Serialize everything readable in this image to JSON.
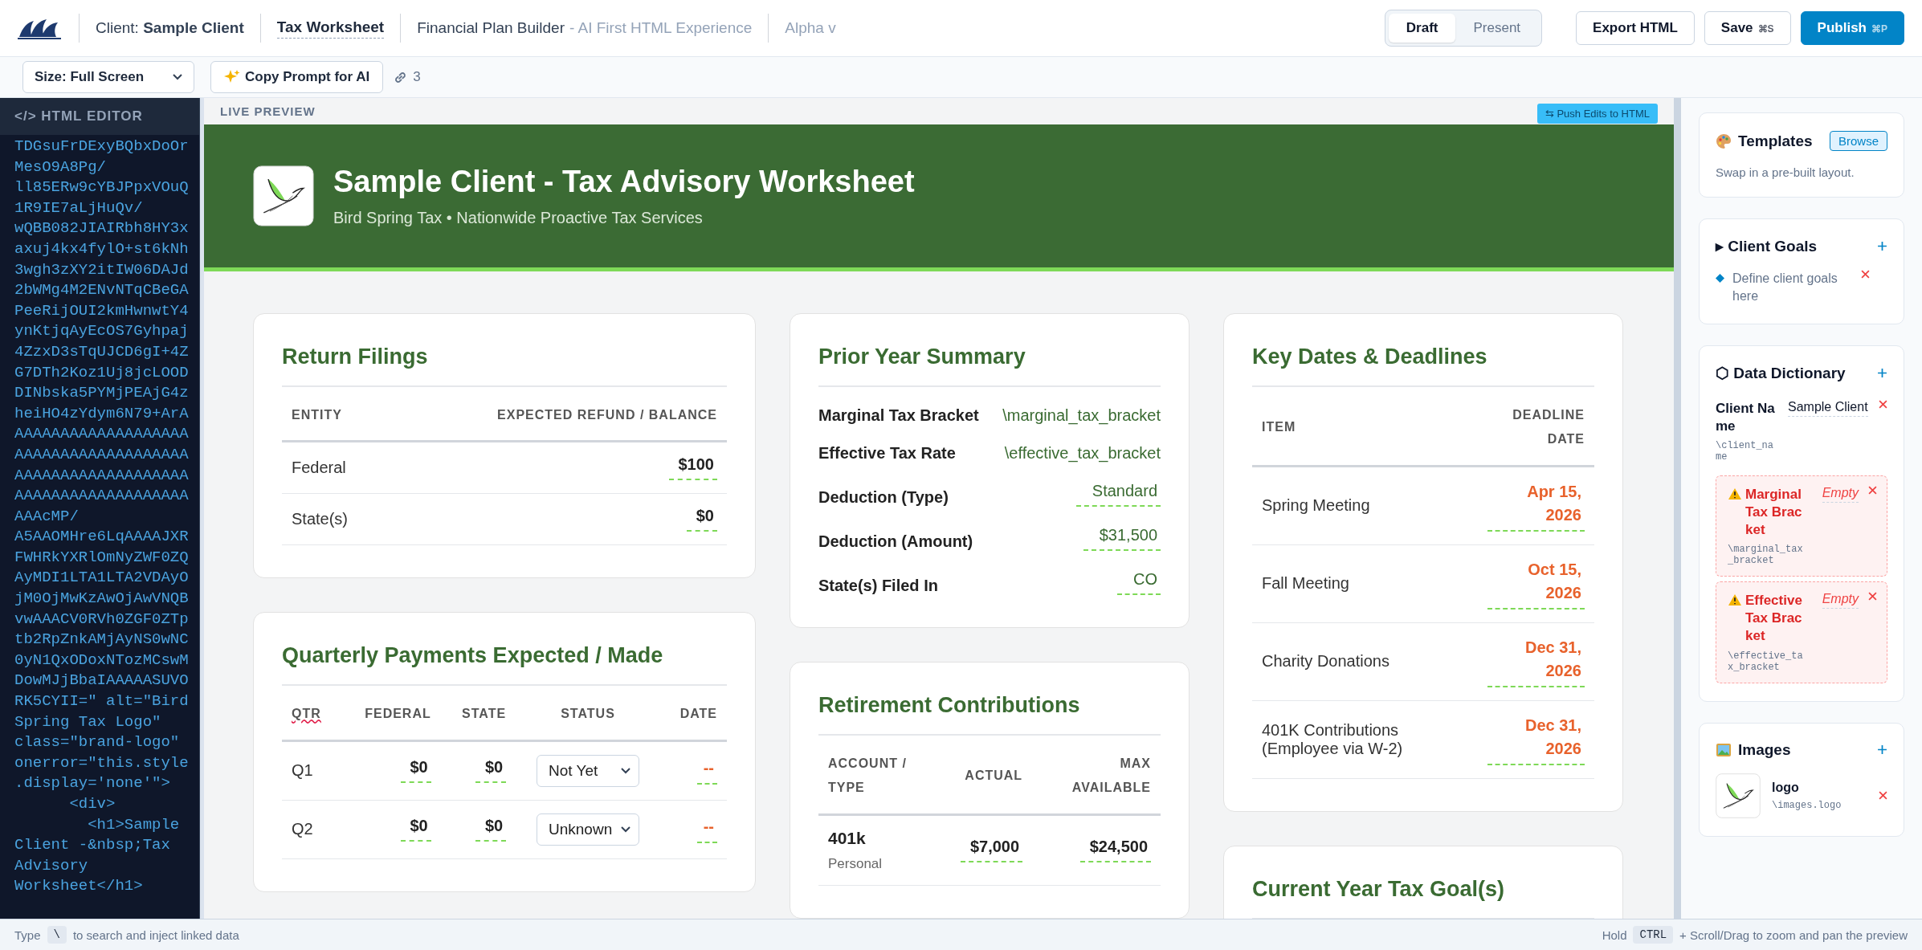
{
  "header": {
    "client_label": "Client: **Sample Client**",
    "document_tab": "Tax Worksheet",
    "app_name": "Financial Plan Builder",
    "app_tagline": "- AI First HTML Experience",
    "version": "Alpha v",
    "modes": [
      {
        "label": "Draft",
        "selected": true
      },
      {
        "label": "Present",
        "selected": false
      }
    ],
    "actions": [
      {
        "label": "Export HTML",
        "kind": "outline"
      },
      {
        "label": "Save",
        "shortcut": "⌘S",
        "kind": "outline"
      },
      {
        "label": "Publish",
        "shortcut": "⌘P",
        "kind": "primary"
      }
    ]
  },
  "toolbar": {
    "size_select": "Size: Full Screen",
    "copy_prompt": "Copy Prompt for AI",
    "link_count": "3"
  },
  "editor": {
    "title": "</> HTML EDITOR",
    "lines": [
      "TDGsuFrDExyBQbxDoOr",
      "MesO9A8Pg/",
      "ll85ERw9cYBJPpxVOuQ",
      "1R9IE7aLjHuQv/",
      "wQBB082JIAIRbh8HY3x",
      "axuj4kx4fylO+st6kNh",
      "3wgh3zXY2itIW06DAJd",
      "2bWMg4M2ENvNTqCBeGA",
      "PeeRijOUI2kmHwnwtY4",
      "ynKtjqAyEcOS7Gyhpaj",
      "4ZzxD3sTqUJCD6gI+4Z",
      "G7DTh2Koz1Uj8jcLOOD",
      "DINbska5PYMjPEAjG4z",
      "heiHO4zYdym6N79+ArA",
      "AAAAAAAAAAAAAAAAAAA",
      "AAAAAAAAAAAAAAAAAAA",
      "AAAAAAAAAAAAAAAAAAA",
      "AAAAAAAAAAAAAAAAAAA",
      "AAAcMP/",
      "A5AAOMHre6LqAAAAJXR",
      "FWHRkYXRlOmNyZWF0ZQ",
      "AyMDI1LTA1LTA2VDAyO",
      "jM0OjMwKzAwOjAwVNQB",
      "vwAAACV0RVh0ZGF0ZTp",
      "tb2RpZnkAMjAyNS0wNC",
      "0yN1QxODoxNTozMCswM",
      "DowMJjBbaIAAAAASUVO",
      "RK5CYII=\" alt=\"Bird",
      "Spring Tax Logo\"",
      "class=\"brand-logo\"",
      "onerror=\"this.style",
      ".display='none'\">",
      "      <div>",
      "        <h1>Sample",
      "Client -&nbsp;Tax",
      "Advisory",
      "Worksheet</h1>"
    ]
  },
  "preview": {
    "label": "LIVE PREVIEW",
    "push_button": "⇆ Push Edits to HTML",
    "banner": {
      "title": "Sample Client - Tax Advisory Worksheet",
      "subtitle": "Bird Spring Tax • Nationwide Proactive Tax Services"
    },
    "columns": [
      [
        {
          "kind": "table",
          "title": "Return Filings",
          "columns": [
            {
              "label": "ENTITY",
              "misspelled": false
            },
            {
              "label": "EXPECTED REFUND / BALANCE",
              "misspelled": false
            }
          ],
          "rows": [
            {
              "cells": [
                {
                  "kind": "plain",
                  "text": "Federal"
                },
                {
                  "kind": "field",
                  "text": "$100"
                }
              ]
            },
            {
              "cells": [
                {
                  "kind": "plain",
                  "text": "State(s)"
                },
                {
                  "kind": "field",
                  "text": "$0"
                }
              ]
            }
          ]
        },
        {
          "kind": "table",
          "title": "Quarterly Payments Expected / Made",
          "columns": [
            {
              "label": "QTR",
              "misspelled": true
            },
            {
              "label": "FEDERAL",
              "misspelled": false
            },
            {
              "label": "STATE",
              "misspelled": false
            },
            {
              "label": "STATUS",
              "misspelled": false
            },
            {
              "label": "DATE",
              "misspelled": false
            }
          ],
          "rows": [
            {
              "cells": [
                {
                  "kind": "plain",
                  "text": "Q1"
                },
                {
                  "kind": "field",
                  "text": "$0"
                },
                {
                  "kind": "field",
                  "text": "$0"
                },
                {
                  "kind": "select",
                  "text": "Not Yet"
                },
                {
                  "kind": "date",
                  "text": "--"
                }
              ]
            },
            {
              "cells": [
                {
                  "kind": "plain",
                  "text": "Q2"
                },
                {
                  "kind": "field",
                  "text": "$0"
                },
                {
                  "kind": "field",
                  "text": "$0"
                },
                {
                  "kind": "select",
                  "text": "Unknown"
                },
                {
                  "kind": "date",
                  "text": "--"
                }
              ]
            }
          ]
        }
      ],
      [
        {
          "kind": "summary",
          "title": "Prior Year Summary",
          "items": [
            {
              "label": "Marginal Tax Bracket",
              "value": "\\marginal_tax_bracket",
              "kind": "token"
            },
            {
              "label": "Effective Tax Rate",
              "value": "\\effective_tax_bracket",
              "kind": "token"
            },
            {
              "label": "Deduction (Type)",
              "value": "Standard",
              "kind": "field"
            },
            {
              "label": "Deduction (Amount)",
              "value": "$31,500",
              "kind": "field"
            },
            {
              "label": "State(s) Filed In",
              "value": "CO",
              "kind": "field"
            }
          ]
        },
        {
          "kind": "table",
          "title": "Retirement Contributions",
          "columns": [
            {
              "label": "ACCOUNT / TYPE",
              "misspelled": false
            },
            {
              "label": "ACTUAL",
              "misspelled": false
            },
            {
              "label": "MAX AVAILABLE",
              "misspelled": false
            }
          ],
          "rows": [
            {
              "cells": [
                {
                  "kind": "account",
                  "text": "401k",
                  "sub": "Personal"
                },
                {
                  "kind": "field",
                  "text": "$7,000"
                },
                {
                  "kind": "field",
                  "text": "$24,500"
                }
              ]
            }
          ]
        }
      ],
      [
        {
          "kind": "table",
          "title": "Key Dates & Deadlines",
          "columns": [
            {
              "label": "ITEM",
              "misspelled": false
            },
            {
              "label": "DEADLINE DATE",
              "misspelled": false
            }
          ],
          "rows": [
            {
              "cells": [
                {
                  "kind": "plain",
                  "text": "Spring Meeting"
                },
                {
                  "kind": "date",
                  "text": "Apr 15, 2026"
                }
              ]
            },
            {
              "cells": [
                {
                  "kind": "plain",
                  "text": "Fall Meeting"
                },
                {
                  "kind": "date",
                  "text": "Oct 15, 2026"
                }
              ]
            },
            {
              "cells": [
                {
                  "kind": "plain",
                  "text": "Charity Donations"
                },
                {
                  "kind": "date",
                  "text": "Dec 31, 2026"
                }
              ]
            },
            {
              "cells": [
                {
                  "kind": "plain",
                  "text": "401K Contributions (Employee via W-2)"
                },
                {
                  "kind": "date",
                  "text": "Dec 31, 2026"
                }
              ]
            }
          ]
        },
        {
          "kind": "heading",
          "title": "Current Year Tax Goal(s)"
        }
      ]
    ]
  },
  "sidebar": {
    "templates": {
      "title": "Templates",
      "button": "Browse",
      "note": "Swap in a pre-built layout."
    },
    "client_goals": {
      "title": "▸ Client Goals",
      "items": [
        {
          "text": "Define client goals here"
        }
      ]
    },
    "data_dictionary": {
      "title": "⬡ Data Dictionary",
      "entries": [
        {
          "label": "Client Name",
          "key": "\\client_name",
          "value": "Sample Client",
          "empty": false
        },
        {
          "label": "Marginal Tax Bracket",
          "key": "\\marginal_tax_bracket",
          "value": "Empty",
          "empty": true
        },
        {
          "label": "Effective Tax Bracket",
          "key": "\\effective_tax_bracket",
          "value": "Empty",
          "empty": true
        }
      ]
    },
    "images": {
      "title": "Images",
      "items": [
        {
          "name": "logo",
          "path": "\\images.logo"
        }
      ]
    }
  },
  "status_bar": {
    "left_prefix": "Type",
    "left_key": "\\",
    "left_text": "to search and inject linked data",
    "right_prefix": "Hold",
    "right_key": "CTRL",
    "right_text": "+ Scroll/Drag to zoom and pan the preview"
  }
}
